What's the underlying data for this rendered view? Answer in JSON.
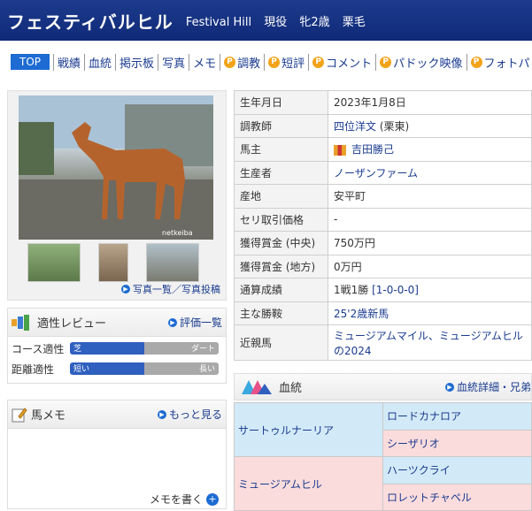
{
  "header": {
    "name": "フェスティバルヒル",
    "name_en": "Festival Hill",
    "status": "現役",
    "sex_age": "牝2歳",
    "color": "栗毛"
  },
  "nav": {
    "top": "TOP",
    "items": [
      {
        "label": "戦績",
        "premium": false
      },
      {
        "label": "血統",
        "premium": false
      },
      {
        "label": "掲示板",
        "premium": false
      },
      {
        "label": "写真",
        "premium": false
      },
      {
        "label": "メモ",
        "premium": false
      },
      {
        "label": "調教",
        "premium": true
      },
      {
        "label": "短評",
        "premium": true
      },
      {
        "label": "コメント",
        "premium": true
      },
      {
        "label": "パドック映像",
        "premium": true
      },
      {
        "label": "フォトパドック",
        "premium": true
      }
    ],
    "premium_icon": "P"
  },
  "photo": {
    "watermark": "netkeiba",
    "links": "写真一覧／写真投稿"
  },
  "review": {
    "title": "適性レビュー",
    "link": "評価一覧",
    "course_label": "コース適性",
    "course_left": "芝",
    "course_right": "ダート",
    "distance_label": "距離適性",
    "distance_left": "短い",
    "distance_right": "長い"
  },
  "memo": {
    "title": "馬メモ",
    "link": "もっと見る",
    "write": "メモを書く"
  },
  "profile": [
    {
      "k": "生年月日",
      "v": "2023年1月8日",
      "link": false
    },
    {
      "k": "調教師",
      "v": "四位洋文",
      "v2": " (栗東)",
      "link": true
    },
    {
      "k": "馬主",
      "v": "吉田勝己",
      "link": true,
      "silks": true
    },
    {
      "k": "生産者",
      "v": "ノーザンファーム",
      "link": true
    },
    {
      "k": "産地",
      "v": "安平町",
      "link": false
    },
    {
      "k": "セリ取引価格",
      "v": "-",
      "link": false
    },
    {
      "k": "獲得賞金 (中央)",
      "v": "750万円",
      "link": false
    },
    {
      "k": "獲得賞金 (地方)",
      "v": "0万円",
      "link": false
    },
    {
      "k": "通算成績",
      "v": "1戦1勝 ",
      "v2": "[1-0-0-0]",
      "link": false
    },
    {
      "k": "主な勝鞍",
      "v": "25'2歳新馬",
      "link": true
    },
    {
      "k": "近親馬",
      "v": "ミュージアムマイル、ミュージアムヒルの2024",
      "link": true
    }
  ],
  "pedigree": {
    "title": "血統",
    "link": "血統詳細・兄弟",
    "sire": "サートゥルナーリア",
    "sire_sire": "ロードカナロア",
    "sire_dam": "シーザリオ",
    "dam": "ミュージアムヒル",
    "dam_sire": "ハーツクライ",
    "dam_dam": "ロレットチャペル"
  }
}
